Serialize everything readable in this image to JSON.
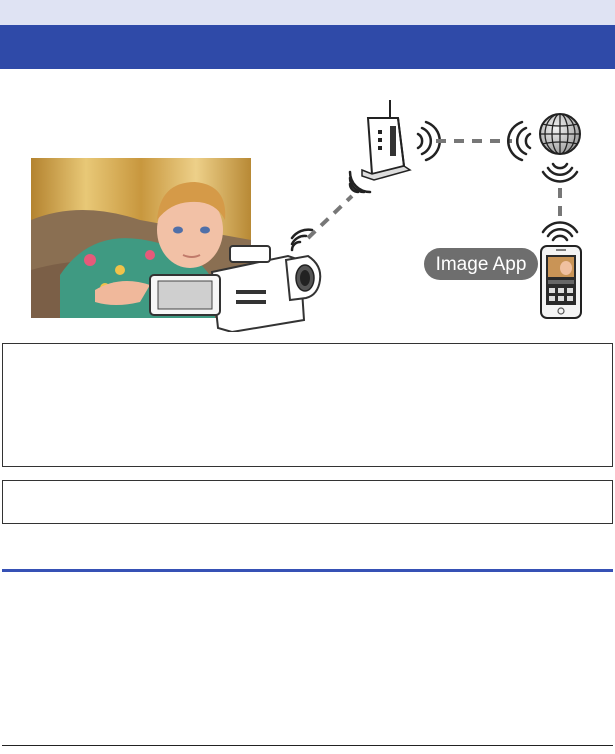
{
  "header": {
    "title": ""
  },
  "diagram": {
    "app_badge": "Image App",
    "colors": {
      "title_bar": "#2f4aa8",
      "top_strip": "#dfe3f3",
      "dash_line": "#777777",
      "badge": "#6e6e6e"
    },
    "icons": [
      "wireless-router-icon",
      "internet-globe-icon",
      "smartphone-icon",
      "camcorder-icon",
      "wifi-signal-icon"
    ]
  },
  "note_box": {
    "text": ""
  },
  "note_box_2": {
    "text": ""
  }
}
